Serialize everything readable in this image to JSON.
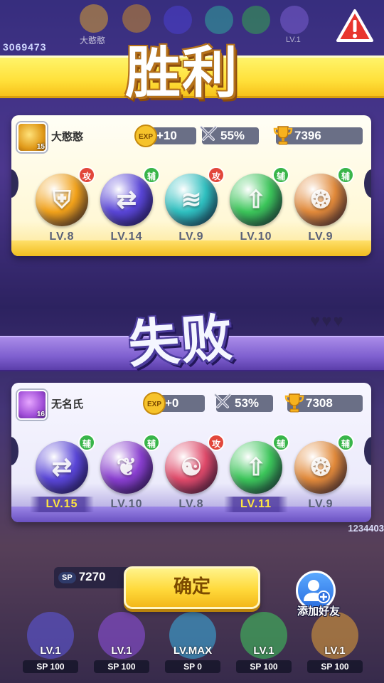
{
  "background": {
    "score_top": "3069473",
    "name_top": "大憨憨",
    "lv_top": "LV.1",
    "score_right": "1234403",
    "sp_value": "7270",
    "sp_label": "SP",
    "bottom_slots": [
      {
        "lv": "LV.1",
        "sp": "100",
        "color": "#5d57d9"
      },
      {
        "lv": "LV.1",
        "sp": "100",
        "color": "#8a4fd8"
      },
      {
        "lv": "LV.MAX",
        "sp": "0",
        "color": "#3aa9d8"
      },
      {
        "lv": "LV.1",
        "sp": "100",
        "color": "#3fbf5c"
      },
      {
        "lv": "LV.1",
        "sp": "100",
        "color": "#d89a3a"
      }
    ],
    "sp_badge": "SP"
  },
  "win": {
    "banner": "胜利",
    "player": {
      "name": "大憨憨",
      "level": "15",
      "exp": "+10",
      "win_rate": "55%",
      "trophies": "7396"
    },
    "heroes": [
      {
        "lv": "LV.8",
        "tag": "攻",
        "tag_type": "atk",
        "icon": "knight-helmet-icon",
        "color": "#f2a21a",
        "glyph": "⛨"
      },
      {
        "lv": "LV.14",
        "tag": "辅",
        "tag_type": "sup",
        "icon": "swap-arrows-icon",
        "color": "#5a46d8",
        "glyph": "⇄"
      },
      {
        "lv": "LV.9",
        "tag": "攻",
        "tag_type": "atk",
        "icon": "tornado-icon",
        "color": "#2fc0c0",
        "glyph": "≋"
      },
      {
        "lv": "LV.10",
        "tag": "辅",
        "tag_type": "sup",
        "icon": "up-arrow-icon",
        "color": "#3cc65a",
        "glyph": "⇧"
      },
      {
        "lv": "LV.9",
        "tag": "辅",
        "tag_type": "sup",
        "icon": "clone-figures-icon",
        "color": "#e28a3a",
        "glyph": "❂"
      }
    ]
  },
  "lose": {
    "banner": "失败",
    "player": {
      "name": "无名氏",
      "level": "16",
      "exp": "+0",
      "win_rate": "53%",
      "trophies": "7308"
    },
    "heroes": [
      {
        "lv": "LV.15",
        "tag": "辅",
        "tag_type": "sup",
        "icon": "swap-arrows-icon",
        "color": "#5a46d8",
        "glyph": "⇄",
        "highlight": true
      },
      {
        "lv": "LV.10",
        "tag": "辅",
        "tag_type": "sup",
        "icon": "leaf-icon",
        "color": "#8a3fd0",
        "glyph": "❦",
        "highlight": false
      },
      {
        "lv": "LV.8",
        "tag": "攻",
        "tag_type": "atk",
        "icon": "swirl-icon",
        "color": "#e04a6a",
        "glyph": "☯",
        "highlight": false
      },
      {
        "lv": "LV.11",
        "tag": "辅",
        "tag_type": "sup",
        "icon": "up-arrow-icon",
        "color": "#3cc65a",
        "glyph": "⇧",
        "highlight": true
      },
      {
        "lv": "LV.9",
        "tag": "辅",
        "tag_type": "sup",
        "icon": "clone-figures-icon",
        "color": "#e28a3a",
        "glyph": "❂",
        "highlight": false
      }
    ]
  },
  "actions": {
    "confirm": "确定",
    "add_friend": "添加好友"
  },
  "colors": {
    "win_banner": "#ffe03a",
    "lose_banner": "#7e5fcf",
    "attack_tag": "#e2473b",
    "support_tag": "#39b54a",
    "highlight_lv": "#ffe640"
  }
}
